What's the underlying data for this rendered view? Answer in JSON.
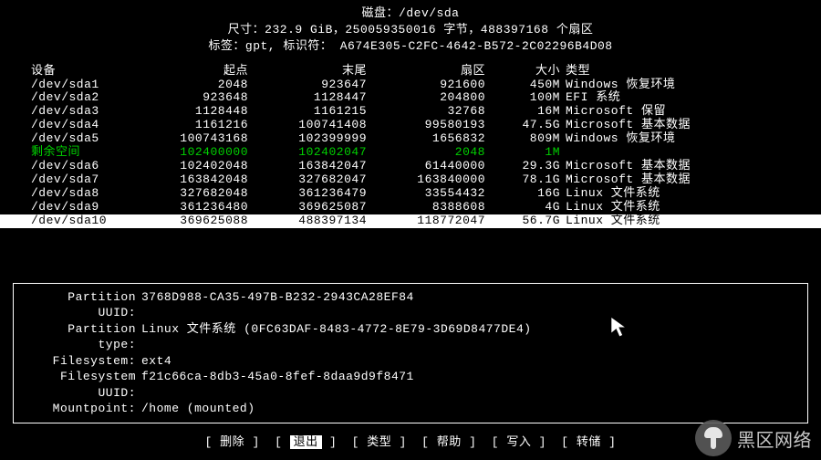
{
  "header": {
    "line1_label": "磁盘：",
    "line1_value": "/dev/sda",
    "line2": "尺寸：232.9 GiB，250059350016 字节，488397168 个扇区",
    "line3_left": "标签：gpt,",
    "line3_mid": "标识符：",
    "line3_right": "A674E305-C2FC-4642-B572-2C02296B4D08"
  },
  "columns": {
    "dev": "设备",
    "start": "起点",
    "end": "末尾",
    "sectors": "扇区",
    "size": "大小",
    "type": "类型"
  },
  "rows": [
    {
      "dev": "/dev/sda1",
      "start": "2048",
      "end": "923647",
      "sectors": "921600",
      "size": "450M",
      "type": "Windows 恢复环境"
    },
    {
      "dev": "/dev/sda2",
      "start": "923648",
      "end": "1128447",
      "sectors": "204800",
      "size": "100M",
      "type": "EFI 系统"
    },
    {
      "dev": "/dev/sda3",
      "start": "1128448",
      "end": "1161215",
      "sectors": "32768",
      "size": "16M",
      "type": "Microsoft 保留"
    },
    {
      "dev": "/dev/sda4",
      "start": "1161216",
      "end": "100741408",
      "sectors": "99580193",
      "size": "47.5G",
      "type": "Microsoft 基本数据"
    },
    {
      "dev": "/dev/sda5",
      "start": "100743168",
      "end": "102399999",
      "sectors": "1656832",
      "size": "809M",
      "type": "Windows 恢复环境"
    },
    {
      "dev": "剩余空间",
      "start": "102400000",
      "end": "102402047",
      "sectors": "2048",
      "size": "1M",
      "type": "",
      "green": true
    },
    {
      "dev": "/dev/sda6",
      "start": "102402048",
      "end": "163842047",
      "sectors": "61440000",
      "size": "29.3G",
      "type": "Microsoft 基本数据"
    },
    {
      "dev": "/dev/sda7",
      "start": "163842048",
      "end": "327682047",
      "sectors": "163840000",
      "size": "78.1G",
      "type": "Microsoft 基本数据"
    },
    {
      "dev": "/dev/sda8",
      "start": "327682048",
      "end": "361236479",
      "sectors": "33554432",
      "size": "16G",
      "type": "Linux 文件系统"
    },
    {
      "dev": "/dev/sda9",
      "start": "361236480",
      "end": "369625087",
      "sectors": "8388608",
      "size": "4G",
      "type": "Linux 文件系统"
    },
    {
      "dev": "/dev/sda10",
      "start": "369625088",
      "end": "488397134",
      "sectors": "118772047",
      "size": "56.7G",
      "type": "Linux 文件系统",
      "selected": true
    }
  ],
  "info": [
    {
      "label": "Partition UUID:",
      "value": "3768D988-CA35-497B-B232-2943CA28EF84"
    },
    {
      "label": "Partition type:",
      "value": "Linux 文件系统 (0FC63DAF-8483-4772-8E79-3D69D8477DE4)"
    },
    {
      "label": "Filesystem:",
      "value": "ext4"
    },
    {
      "label": "Filesystem UUID:",
      "value": "f21c66ca-8db3-45a0-8fef-8daa9d9f8471"
    },
    {
      "label": "Mountpoint:",
      "value": "/home (mounted)"
    }
  ],
  "menu": [
    {
      "label": "删除",
      "active": false
    },
    {
      "label": "退出",
      "active": true
    },
    {
      "label": "类型",
      "active": false
    },
    {
      "label": "帮助",
      "active": false
    },
    {
      "label": "写入",
      "active": false
    },
    {
      "label": "转储",
      "active": false
    }
  ],
  "watermark": {
    "text": "黑区网络"
  },
  "marker": ">>"
}
